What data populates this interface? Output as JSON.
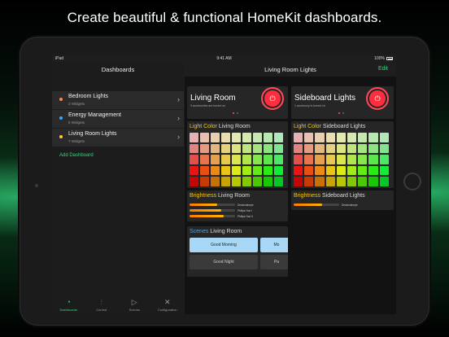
{
  "headline": "Create beautiful & functional HomeKit dashboards.",
  "status_bar": {
    "device": "iPad",
    "time": "9:41 AM",
    "battery": "100%"
  },
  "sidebar": {
    "title": "Dashboards",
    "items": [
      {
        "name": "Bedroom Lights",
        "sub": "2 Widgets",
        "color": "#ff8a3d"
      },
      {
        "name": "Energy Management",
        "sub": "6 Widgets",
        "color": "#3aa8ff"
      },
      {
        "name": "Living Room Lights",
        "sub": "7 Widgets",
        "color": "#ffc53d"
      }
    ],
    "add_label": "Add Dashboard",
    "tabs": [
      {
        "label": "Dashboards",
        "icon": "dashboard-icon",
        "active": true
      },
      {
        "label": "Control",
        "icon": "sliders-icon",
        "active": false
      },
      {
        "label": "Scenes",
        "icon": "play-icon",
        "active": false
      },
      {
        "label": "Configuration",
        "icon": "tools-icon",
        "active": false
      }
    ]
  },
  "main": {
    "title": "Living Room Lights",
    "edit_label": "Edit",
    "panels": [
      {
        "room": "Living Room",
        "room_sub": "3 accessories are turned on",
        "light_label_a": "Light Color",
        "light_label_b": "Living Room",
        "brightness_a": "Brightness",
        "brightness_b": "Living Room",
        "bars": [
          {
            "label": "Deckenlampe",
            "value": 0.6
          },
          {
            "label": "Philips Hue I",
            "value": 0.7
          },
          {
            "label": "Philips Hue II",
            "value": 0.75
          }
        ],
        "scenes_a": "Scenes",
        "scenes_b": "Living Room",
        "scenes": [
          "Good Morning",
          "Mo",
          "Good Night",
          "Pa"
        ]
      },
      {
        "room": "Sideboard Lights",
        "room_sub": "1 accessory is turned on",
        "light_label_a": "Light Color",
        "light_label_b": "Sideboard Lights",
        "brightness_a": "Brightness",
        "brightness_b": "Sideboard Lights",
        "bars": [
          {
            "label": "Deckenlampe",
            "value": 0.62
          }
        ]
      }
    ]
  },
  "colors": {
    "accent": "#37d67a",
    "title_yellow": "#f5c518",
    "power_red": "#ff2d3d",
    "scene_blue": "#a8d8f5",
    "scene_gray": "#3a3a3a"
  }
}
